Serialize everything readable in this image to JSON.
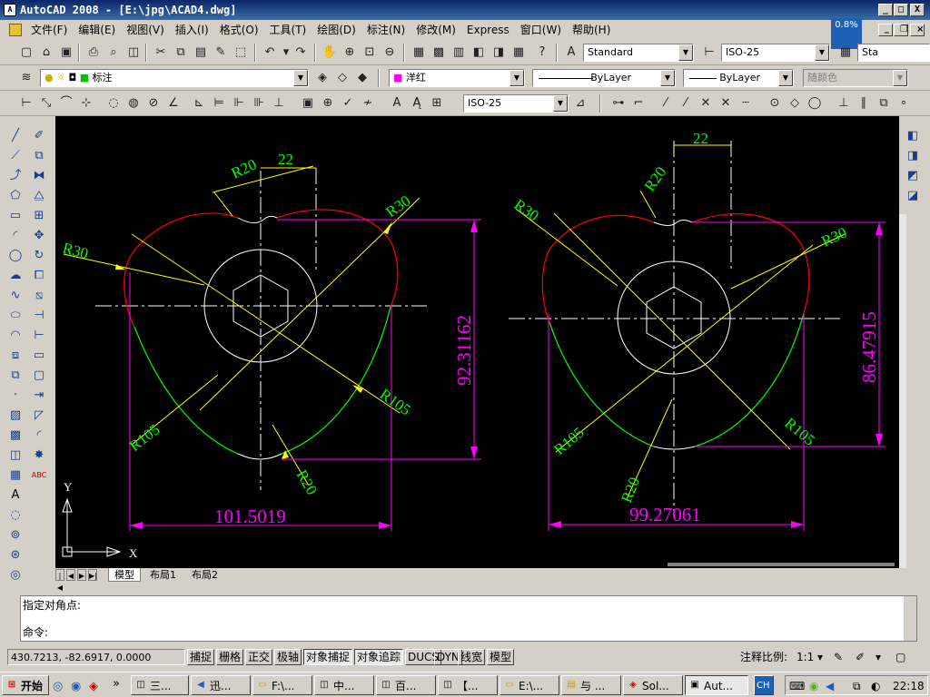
{
  "window": {
    "title": "AutoCAD 2008 - [E:\\jpg\\ACAD4.dwg]",
    "min": "_",
    "max": "□",
    "close": "X"
  },
  "menu": [
    "文件(F)",
    "编辑(E)",
    "视图(V)",
    "插入(I)",
    "格式(O)",
    "工具(T)",
    "绘图(D)",
    "标注(N)",
    "修改(M)",
    "Express",
    "窗口(W)",
    "帮助(H)"
  ],
  "zoom_tip": "0.8%",
  "toolbar1": {
    "text_style": "Standard",
    "dim_style": "ISO-25",
    "partial": "Sta"
  },
  "toolbar2": {
    "layer": "标注",
    "color": "洋红",
    "linetype": "ByLayer",
    "lineweight": "ByLayer",
    "plotstyle": "随颜色"
  },
  "toolbar3": {
    "dim_style": "ISO-25"
  },
  "drawing": {
    "left": {
      "r20": "R20",
      "d22": "22",
      "r30a": "R30",
      "r30b": "R30",
      "r105a": "R105",
      "r105b": "R105",
      "r20b": "R20",
      "height": "92.31162",
      "width": "101.5019"
    },
    "right": {
      "r20": "R20",
      "d22": "22",
      "r30a": "R30",
      "r30b": "R30",
      "r105a": "R105",
      "r105b": "R105",
      "r20b": "R20",
      "height": "86.47915",
      "width": "99.27061"
    },
    "ucs": {
      "x": "X",
      "y": "Y"
    },
    "colors": {
      "dimension": "#ff00ff",
      "text": "#00ff00",
      "leader": "#ffff00",
      "red_arc": "#ff0000",
      "green_arc": "#00ff00"
    }
  },
  "tabs": [
    "模型",
    "布局1",
    "布局2"
  ],
  "command": {
    "line1": "指定对角点:",
    "line2": "命令:"
  },
  "status": {
    "coords": "430.7213, -82.6917, 0.0000",
    "buttons": [
      "捕捉",
      "栅格",
      "正交",
      "极轴",
      "对象捕捉",
      "对象追踪",
      "DUCS",
      "DYN",
      "线宽",
      "模型"
    ],
    "annotation_scale_label": "注释比例:",
    "annotation_scale": "1:1"
  },
  "taskbar": {
    "start": "开始",
    "tasks": [
      "三...",
      "迅...",
      "F:\\...",
      "中...",
      "百...",
      "【...",
      "E:\\...",
      "与 ...",
      "Sol...",
      "Aut..."
    ],
    "lang": "CH",
    "time": "22:18"
  }
}
